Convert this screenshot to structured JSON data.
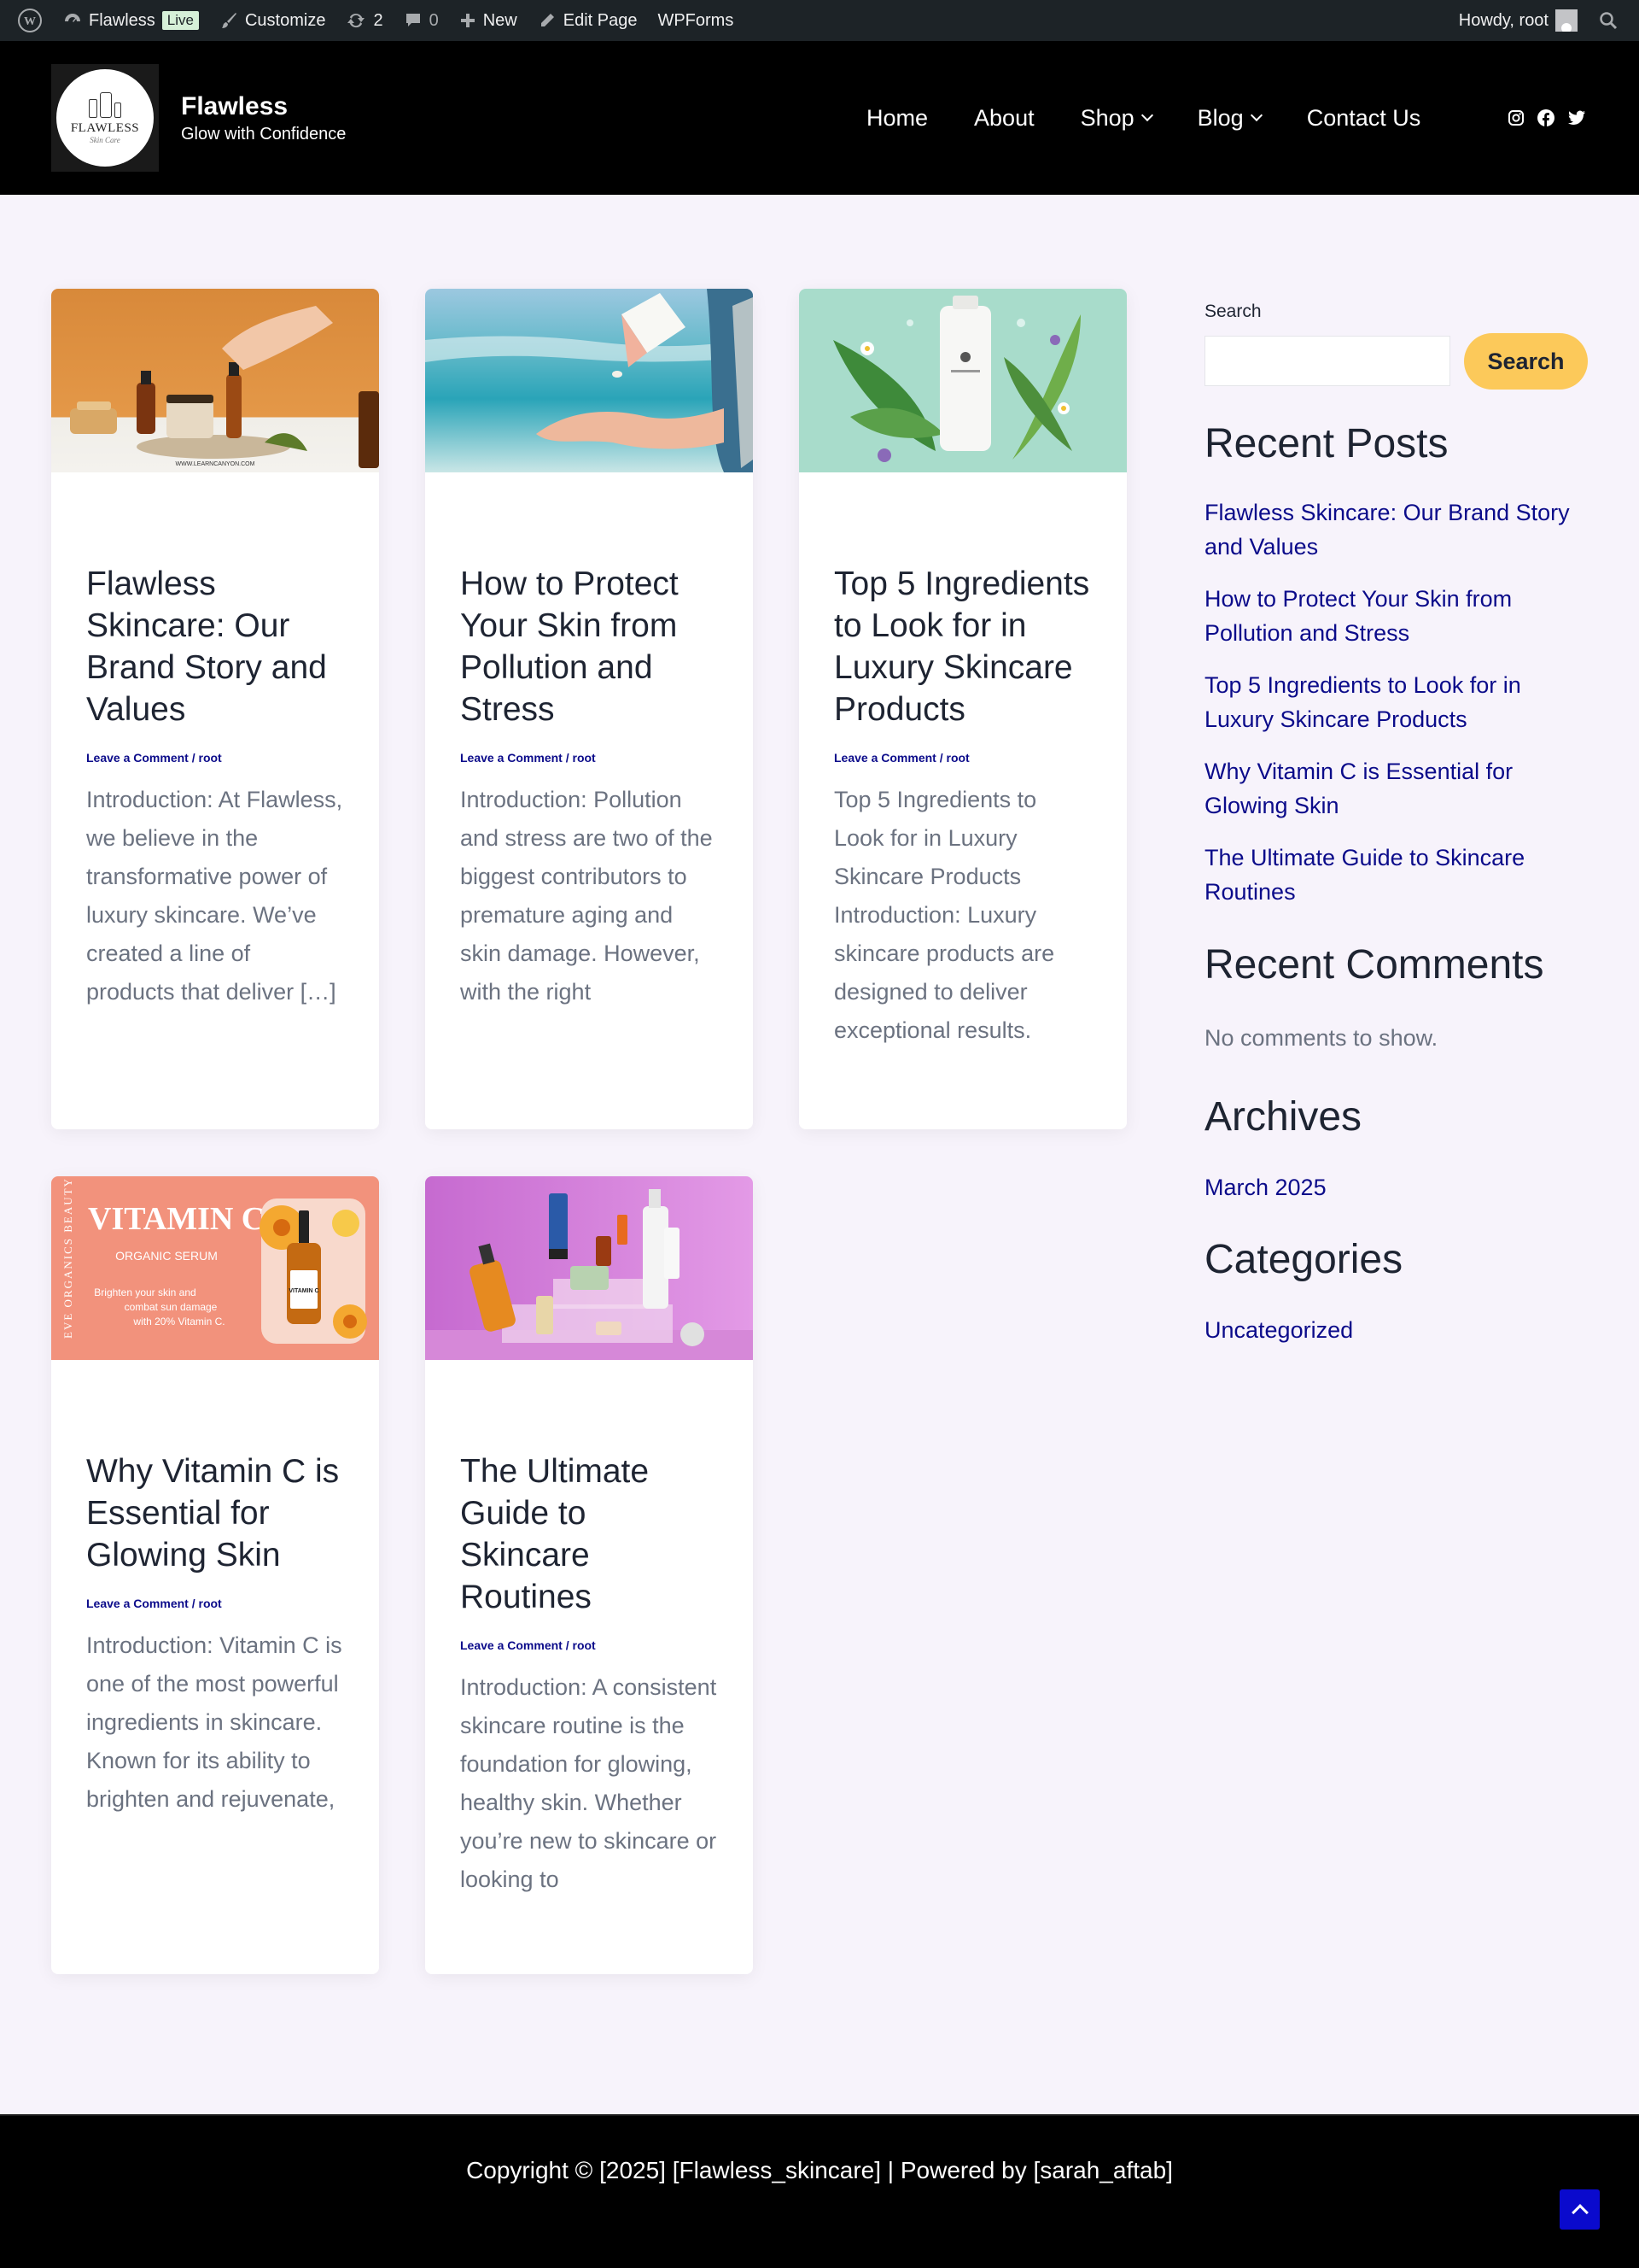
{
  "admin_bar": {
    "site_name": "Flawless",
    "live_badge": "Live",
    "customize": "Customize",
    "updates_count": "2",
    "comments_count": "0",
    "new": "New",
    "edit_page": "Edit Page",
    "wpforms": "WPForms",
    "howdy": "Howdy, root"
  },
  "header": {
    "logo_text": "FLAWLESS",
    "logo_sub": "Skin Care",
    "site_title": "Flawless",
    "tagline": "Glow with Confidence",
    "nav": [
      {
        "label": "Home"
      },
      {
        "label": "About"
      },
      {
        "label": "Shop"
      },
      {
        "label": "Blog"
      },
      {
        "label": "Contact Us"
      }
    ]
  },
  "posts": [
    {
      "title": "Flawless Skincare: Our Brand Story and Values",
      "comment_link": "Leave a Comment",
      "separator": " / ",
      "author": "root",
      "excerpt": "Introduction: At Flawless, we believe in the transformative power of luxury skincare. We’ve created a line of products that deliver […]",
      "image_caption": "WWW.LEARNCANYON.COM"
    },
    {
      "title": "How to Protect Your Skin from Pollution and Stress",
      "comment_link": "Leave a Comment",
      "separator": " / ",
      "author": "root",
      "excerpt": "Introduction: Pollution and stress are two of the biggest contributors to premature aging and skin damage. However, with the right"
    },
    {
      "title": "Top 5 Ingredients to Look for in Luxury Skincare Products",
      "comment_link": "Leave a Comment",
      "separator": " / ",
      "author": "root",
      "excerpt": "Top 5 Ingredients to Look for in Luxury Skincare Products Introduction: Luxury skincare products are designed to deliver exceptional results."
    },
    {
      "title": "Why Vitamin C is Essential for Glowing Skin",
      "comment_link": "Leave a Comment",
      "separator": " / ",
      "author": "root",
      "excerpt": "Introduction: Vitamin C is one of the most powerful ingredients in skincare. Known for its ability to brighten and rejuvenate,",
      "image_heading": "VITAMIN C",
      "image_sub": "ORGANIC SERUM",
      "image_text": "Brighten your skin and combat sun damage with 20% Vitamin C.",
      "image_side": "EVE ORGANICS BEAUTY",
      "bottle_label": "VITAMIN C"
    },
    {
      "title": "The Ultimate Guide to Skincare Routines",
      "comment_link": "Leave a Comment",
      "separator": " / ",
      "author": "root",
      "excerpt": "Introduction: A consistent skincare routine is the foundation for glowing, healthy skin. Whether you’re new to skincare or looking to"
    }
  ],
  "sidebar": {
    "search_label": "Search",
    "search_placeholder": "",
    "search_button": "Search",
    "recent_posts_title": "Recent Posts",
    "recent_posts": [
      "Flawless Skincare: Our Brand Story and Values",
      "How to Protect Your Skin from Pollution and Stress",
      "Top 5 Ingredients to Look for in Luxury Skincare Products",
      "Why Vitamin C is Essential for Glowing Skin",
      "The Ultimate Guide to Skincare Routines"
    ],
    "recent_comments_title": "Recent Comments",
    "no_comments": "No comments to show.",
    "archives_title": "Archives",
    "archives": [
      "March 2025"
    ],
    "categories_title": "Categories",
    "categories": [
      "Uncategorized"
    ]
  },
  "footer": {
    "copyright": "Copyright © [2025] [Flawless_skincare] | Powered by [sarah_aftab]"
  },
  "colors": {
    "admin_bar_bg": "#1d2327",
    "header_bg": "#000000",
    "page_bg": "#f7f3fb",
    "link": "#0b0b8a",
    "search_button": "#fcc95a",
    "scroll_top": "#0a0acd"
  }
}
